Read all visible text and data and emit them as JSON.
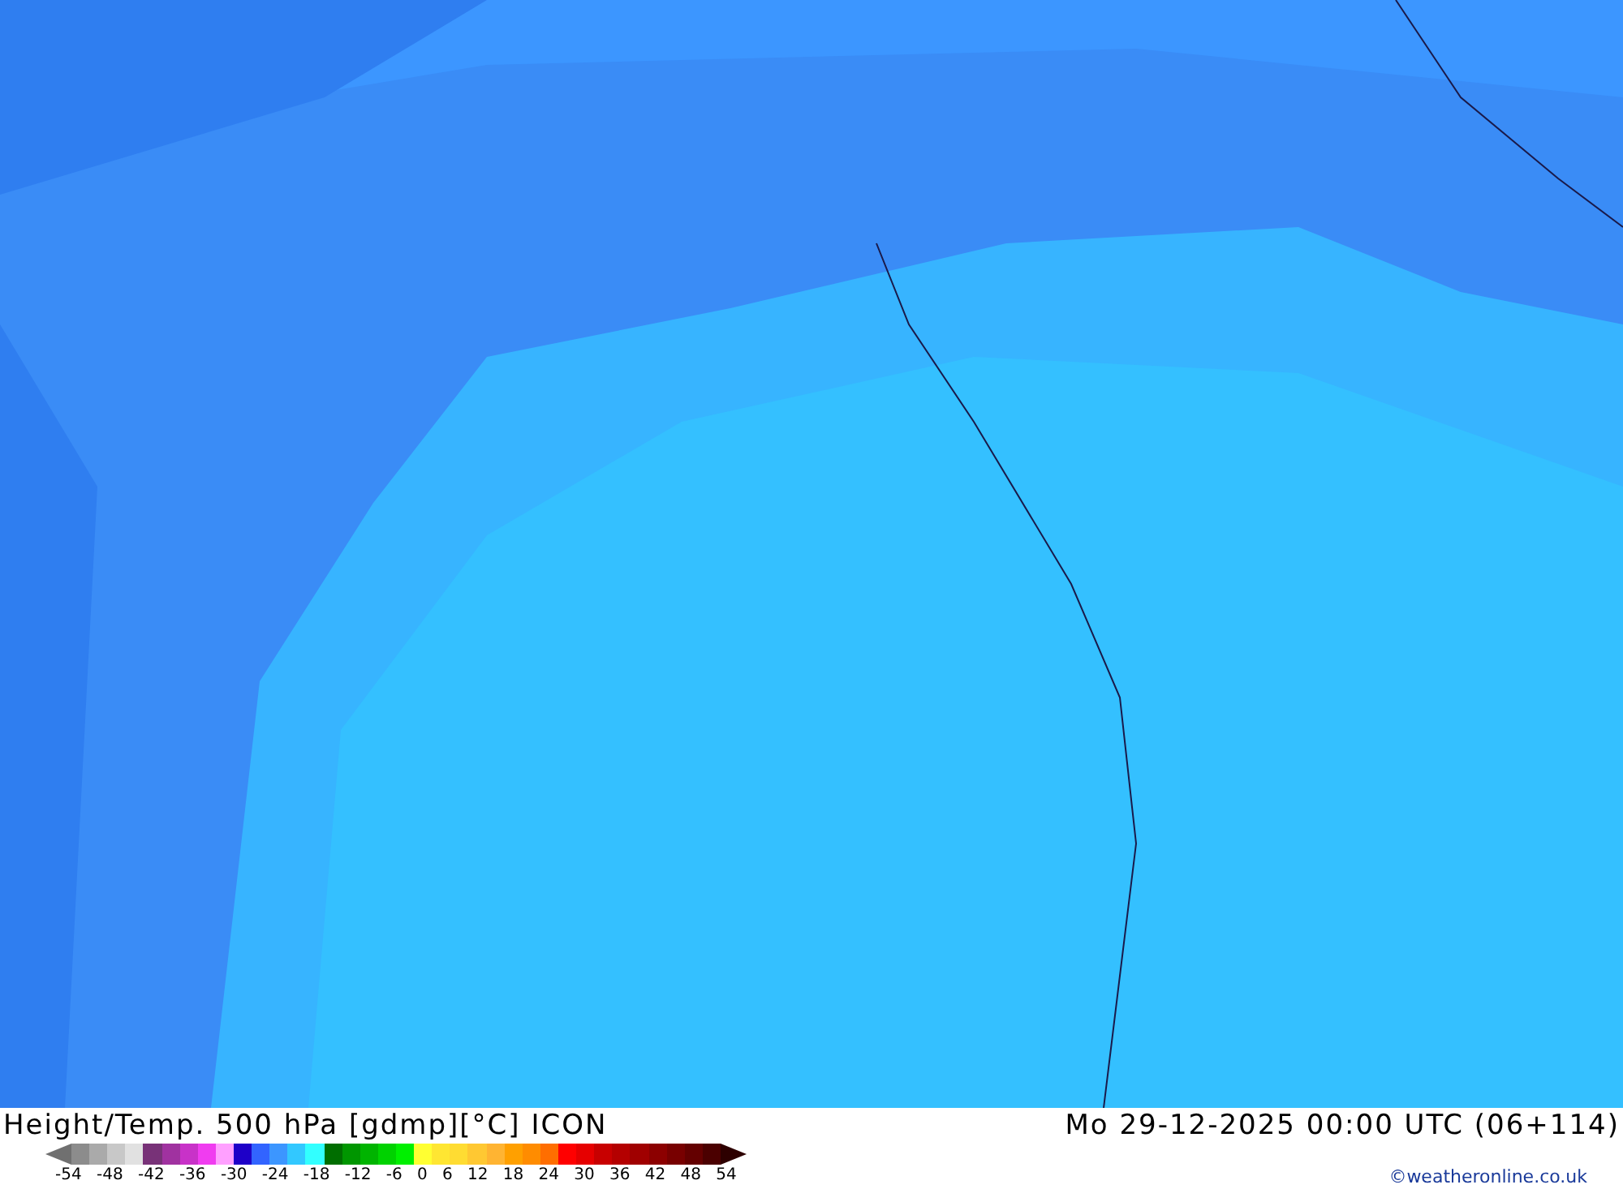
{
  "footer": {
    "title": "Height/Temp. 500 hPa [gdmp][°C] ICON",
    "valid_time": "Mo 29-12-2025 00:00 UTC (06+114)",
    "copyright": "©weatheronline.co.uk"
  },
  "legend": {
    "swatches": [
      {
        "color": "#8c8c8c"
      },
      {
        "color": "#aaaaaa"
      },
      {
        "color": "#c8c8c8"
      },
      {
        "color": "#e1e1e1"
      },
      {
        "color": "#783278"
      },
      {
        "color": "#a032a0"
      },
      {
        "color": "#c832c8"
      },
      {
        "color": "#f03cf0"
      },
      {
        "color": "#ffa0ff"
      },
      {
        "color": "#1e00c8"
      },
      {
        "color": "#3264ff"
      },
      {
        "color": "#3c96ff"
      },
      {
        "color": "#32c8ff"
      },
      {
        "color": "#32ffff"
      },
      {
        "color": "#006e00"
      },
      {
        "color": "#009600"
      },
      {
        "color": "#00b400"
      },
      {
        "color": "#00d200"
      },
      {
        "color": "#00f000"
      },
      {
        "color": "#ffff32"
      },
      {
        "color": "#ffe632"
      },
      {
        "color": "#ffdc32"
      },
      {
        "color": "#ffc832"
      },
      {
        "color": "#ffb432"
      },
      {
        "color": "#ffa000"
      },
      {
        "color": "#ff8c00"
      },
      {
        "color": "#ff6e00"
      },
      {
        "color": "#ff0000"
      },
      {
        "color": "#e60000"
      },
      {
        "color": "#c80000"
      },
      {
        "color": "#b40000"
      },
      {
        "color": "#a00000"
      },
      {
        "color": "#8c0000"
      },
      {
        "color": "#780000"
      },
      {
        "color": "#640000"
      },
      {
        "color": "#4b0000"
      }
    ],
    "ticks": [
      "-54",
      "-48",
      "-42",
      "-36",
      "-30",
      "-24",
      "-18",
      "-12",
      "-6",
      "0",
      "6",
      "12",
      "18",
      "24",
      "30",
      "36",
      "42",
      "48",
      "54"
    ]
  }
}
